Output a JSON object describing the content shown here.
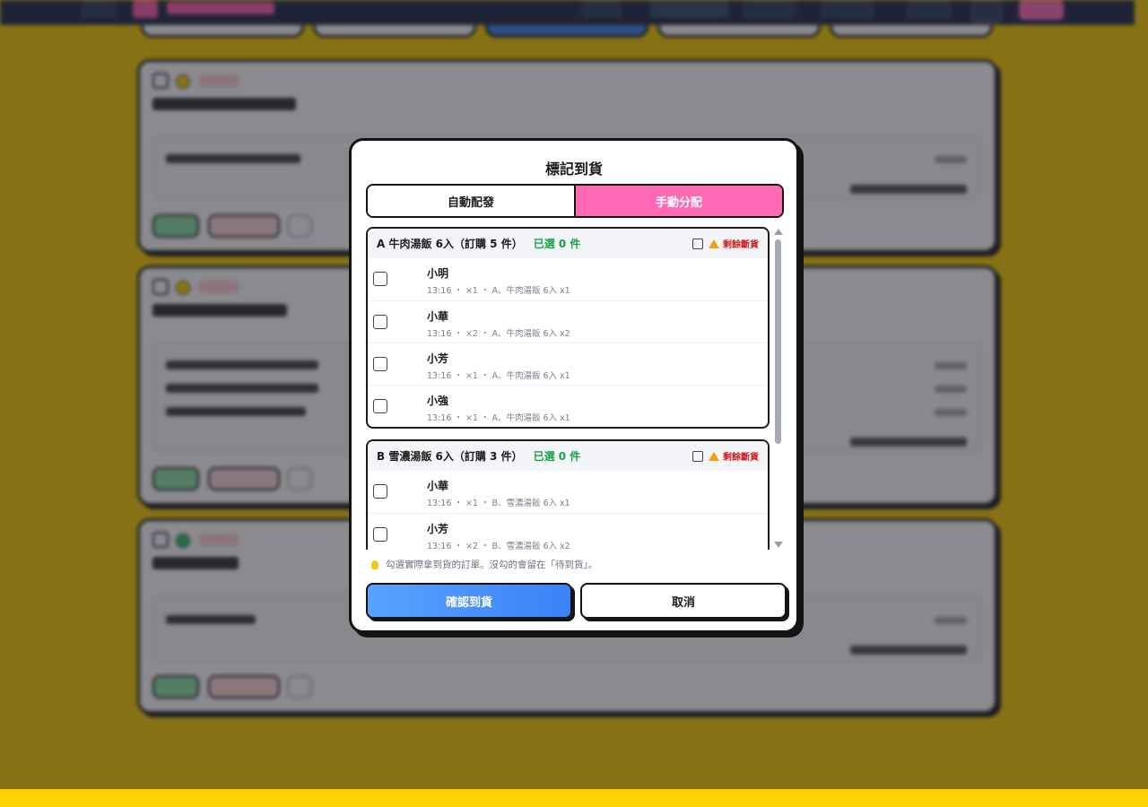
{
  "modal": {
    "title": "標記到貨",
    "tabs": [
      {
        "label": "自動配發",
        "active": false
      },
      {
        "label": "手動分配",
        "active": true
      }
    ],
    "groups": [
      {
        "title": "A 牛肉湯飯 6入（訂購 5 件）",
        "selected": "已選 0 件",
        "out_of_stock_label": "剩餘斷貨",
        "orders": [
          {
            "name": "小明",
            "detail": "13:16 ・ ×1 ・ A、牛肉湯飯 6入 x1"
          },
          {
            "name": "小華",
            "detail": "13:16 ・ ×2 ・ A、牛肉湯飯 6入 x2"
          },
          {
            "name": "小芳",
            "detail": "13:16 ・ ×1 ・ A、牛肉湯飯 6入 x1"
          },
          {
            "name": "小強",
            "detail": "13:16 ・ ×1 ・ A、牛肉湯飯 6入 x1"
          }
        ]
      },
      {
        "title": "B 雪濃湯飯 6入（訂購 3 件）",
        "selected": "已選 0 件",
        "out_of_stock_label": "剩餘斷貨",
        "orders": [
          {
            "name": "小華",
            "detail": "13:16 ・ ×1 ・ B、雪濃湯飯 6入 x1"
          },
          {
            "name": "小芳",
            "detail": "13:16 ・ ×2 ・ B、雪濃湯飯 6入 x2"
          }
        ]
      }
    ],
    "hint": "勾選實際拿到貨的訂單。沒勾的會留在「待到貨」。",
    "confirm_label": "確認到貨",
    "cancel_label": "取消"
  },
  "colors": {
    "accent_pink": "#ff69b4",
    "confirm_blue": "#3b82f6",
    "selected_green": "#18a34a",
    "warning_red": "#d11f1f",
    "background_yellow": "#ffd400"
  }
}
